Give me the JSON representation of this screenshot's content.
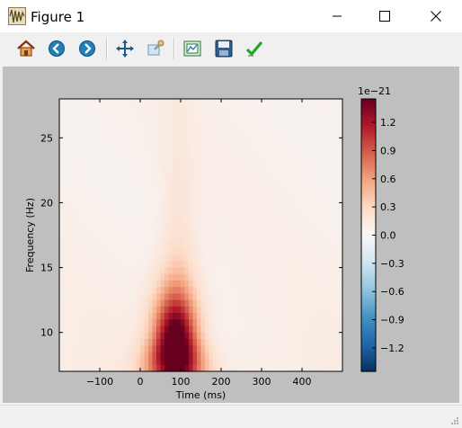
{
  "window": {
    "title": "Figure 1",
    "controls": [
      "minimize",
      "maximize",
      "close"
    ]
  },
  "toolbar": {
    "tools": [
      {
        "name": "home-button",
        "icon": "home-icon"
      },
      {
        "name": "back-button",
        "icon": "back-arrow-icon"
      },
      {
        "name": "forward-button",
        "icon": "forward-arrow-icon"
      },
      {
        "name": "pan-button",
        "icon": "pan-move-icon"
      },
      {
        "name": "zoom-button",
        "icon": "zoom-rect-icon"
      },
      {
        "name": "subplots-button",
        "icon": "subplots-config-icon"
      },
      {
        "name": "save-button",
        "icon": "floppy-save-icon"
      },
      {
        "name": "edit-params-button",
        "icon": "checkmark-icon"
      }
    ]
  },
  "chart_data": {
    "type": "heatmap",
    "title": "",
    "xlabel": "Time (ms)",
    "ylabel": "Frequency (Hz)",
    "xlim": [
      -200,
      500
    ],
    "ylim": [
      7,
      28
    ],
    "xticks": [
      -100,
      0,
      100,
      200,
      300,
      400
    ],
    "yticks": [
      10,
      15,
      20,
      25
    ],
    "xtick_labels": [
      "−100",
      "0",
      "100",
      "200",
      "300",
      "400"
    ],
    "ytick_labels": [
      "10",
      "15",
      "20",
      "25"
    ],
    "colormap": "RdBu_r",
    "colorbar": {
      "offset_label": "1e−21",
      "range": [
        -1.45,
        1.45
      ],
      "ticks": [
        1.2,
        0.9,
        0.6,
        0.3,
        0.0,
        -0.3,
        -0.6,
        -0.9,
        -1.2
      ],
      "tick_labels": [
        "1.2",
        "0.9",
        "0.6",
        "0.3",
        "0.0",
        "−0.3",
        "−0.6",
        "−0.9",
        "−1.2"
      ]
    },
    "peak": {
      "time_ms": 85,
      "frequency_hz": 8.5,
      "value": 1.45
    },
    "colors": {
      "neg": "#053061",
      "zero": "#f7f7f7",
      "pos": "#67001f",
      "background": "#bfbfbf"
    }
  }
}
